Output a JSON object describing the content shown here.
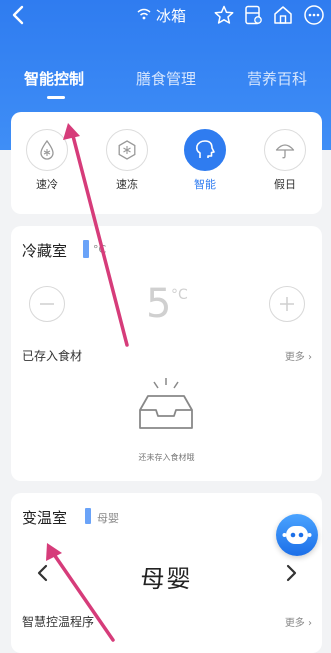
{
  "header": {
    "device_name": "冰箱",
    "tabs": [
      {
        "label": "智能控制",
        "active": true
      },
      {
        "label": "膳食管理",
        "active": false
      },
      {
        "label": "营养百科",
        "active": false
      }
    ]
  },
  "modes": [
    {
      "label": "速冷",
      "icon": "snowflake-drop-icon",
      "active": false
    },
    {
      "label": "速冻",
      "icon": "snowflake-hexagon-icon",
      "active": false
    },
    {
      "label": "智能",
      "icon": "smart-head-icon",
      "active": true
    },
    {
      "label": "假日",
      "icon": "umbrella-icon",
      "active": false
    }
  ],
  "fridge": {
    "title": "冷藏室",
    "tag": "°C",
    "temperature": "5",
    "unit": "°C",
    "stored_label": "已存入食材",
    "more_label": "更多",
    "empty_text": "还未存入食材哦"
  },
  "variable_temp": {
    "title": "变温室",
    "tag": "母婴",
    "mode_name": "母婴",
    "program_label": "智慧控温程序",
    "more_label": "更多"
  },
  "colors": {
    "accent": "#2f7cf0",
    "annotation_arrow": "#d63c7a"
  }
}
